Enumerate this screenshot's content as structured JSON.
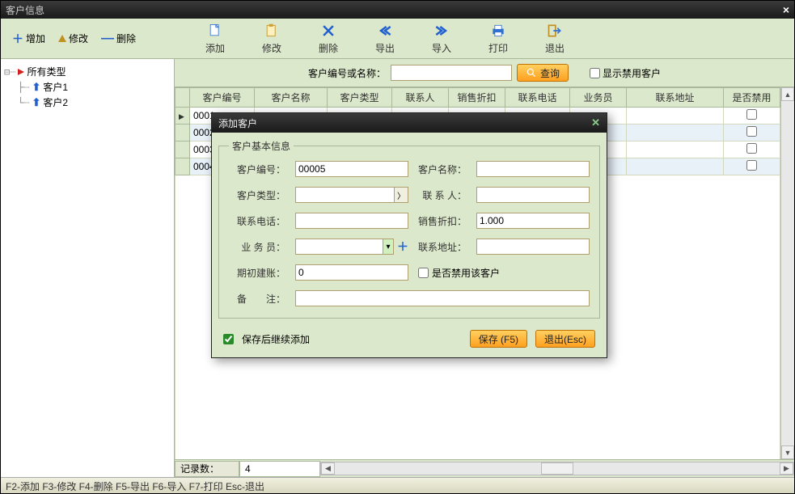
{
  "window": {
    "title": "客户信息"
  },
  "sideTools": {
    "add": "增加",
    "edit": "修改",
    "delete": "删除"
  },
  "toolbar": {
    "add": "添加",
    "edit": "修改",
    "delete": "删除",
    "export": "导出",
    "import": "导入",
    "print": "打印",
    "exit": "退出"
  },
  "search": {
    "label": "客户编号或名称：",
    "value": "",
    "button": "查询",
    "showDisabled": "显示禁用客户"
  },
  "grid": {
    "columns": [
      "客户编号",
      "客户名称",
      "客户类型",
      "联系人",
      "销售折扣",
      "联系电话",
      "业务员",
      "联系地址",
      "是否禁用"
    ],
    "rows": [
      {
        "code": "0001"
      },
      {
        "code": "0002"
      },
      {
        "code": "0003"
      },
      {
        "code": "0004"
      }
    ]
  },
  "tree": {
    "root": "所有类型",
    "children": [
      "客户1",
      "客户2"
    ]
  },
  "footer": {
    "countLabel": "记录数：",
    "count": "4"
  },
  "status": "F2-添加 F3-修改 F4-删除 F5-导出 F6-导入 F7-打印 Esc-退出",
  "dialog": {
    "title": "添加客户",
    "groupTitle": "客户基本信息",
    "fields": {
      "codeLabel": "客户编号：",
      "code": "00005",
      "nameLabel": "客户名称：",
      "name": "",
      "typeLabel": "客户类型：",
      "type": "",
      "contactLabel": "联 系 人：",
      "contact": "",
      "phoneLabel": "联系电话：",
      "phone": "",
      "discountLabel": "销售折扣：",
      "discount": "1.000",
      "salesmanLabel": "业 务 员：",
      "salesman": "",
      "addressLabel": "联系地址：",
      "address": "",
      "openingLabel": "期初建账：",
      "opening": "0",
      "disableLabel": "是否禁用该客户",
      "remarkLabel": "备　　注：",
      "remark": ""
    },
    "continueAdd": "保存后继续添加",
    "save": "保存 (F5)",
    "exit": "退出(Esc)"
  }
}
